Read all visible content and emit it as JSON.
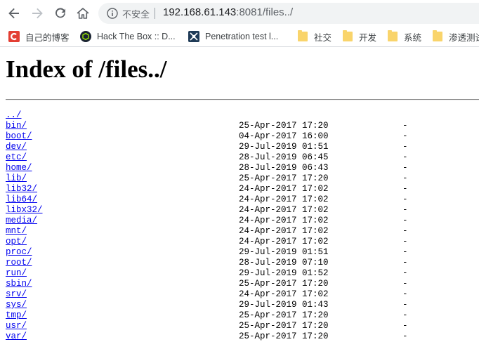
{
  "browser": {
    "security_label": "不安全",
    "url_host": "192.168.61.143",
    "url_rest": ":8081/files../"
  },
  "bookmarks": [
    {
      "label": "自己的博客",
      "icon": "csdn-icon"
    },
    {
      "label": "Hack The Box :: D...",
      "icon": "htb-icon"
    },
    {
      "label": "Penetration test l...",
      "icon": "pentest-icon"
    },
    {
      "label": "社交",
      "icon": "folder-icon"
    },
    {
      "label": "开发",
      "icon": "folder-icon"
    },
    {
      "label": "系统",
      "icon": "folder-icon"
    },
    {
      "label": "渗透测试",
      "icon": "folder-icon"
    }
  ],
  "page": {
    "title": "Index of /files../",
    "parent_link": "../",
    "entries": [
      {
        "name": "bin/",
        "date": "25-Apr-2017 17:20",
        "size": "-"
      },
      {
        "name": "boot/",
        "date": "04-Apr-2017 16:00",
        "size": "-"
      },
      {
        "name": "dev/",
        "date": "29-Jul-2019 01:51",
        "size": "-"
      },
      {
        "name": "etc/",
        "date": "28-Jul-2019 06:45",
        "size": "-"
      },
      {
        "name": "home/",
        "date": "28-Jul-2019 06:43",
        "size": "-"
      },
      {
        "name": "lib/",
        "date": "25-Apr-2017 17:20",
        "size": "-"
      },
      {
        "name": "lib32/",
        "date": "24-Apr-2017 17:02",
        "size": "-"
      },
      {
        "name": "lib64/",
        "date": "24-Apr-2017 17:02",
        "size": "-"
      },
      {
        "name": "libx32/",
        "date": "24-Apr-2017 17:02",
        "size": "-"
      },
      {
        "name": "media/",
        "date": "24-Apr-2017 17:02",
        "size": "-"
      },
      {
        "name": "mnt/",
        "date": "24-Apr-2017 17:02",
        "size": "-"
      },
      {
        "name": "opt/",
        "date": "24-Apr-2017 17:02",
        "size": "-"
      },
      {
        "name": "proc/",
        "date": "29-Jul-2019 01:51",
        "size": "-"
      },
      {
        "name": "root/",
        "date": "28-Jul-2019 07:10",
        "size": "-"
      },
      {
        "name": "run/",
        "date": "29-Jul-2019 01:52",
        "size": "-"
      },
      {
        "name": "sbin/",
        "date": "25-Apr-2017 17:20",
        "size": "-"
      },
      {
        "name": "srv/",
        "date": "24-Apr-2017 17:02",
        "size": "-"
      },
      {
        "name": "sys/",
        "date": "29-Jul-2019 01:43",
        "size": "-"
      },
      {
        "name": "tmp/",
        "date": "25-Apr-2017 17:20",
        "size": "-"
      },
      {
        "name": "usr/",
        "date": "25-Apr-2017 17:20",
        "size": "-"
      },
      {
        "name": "var/",
        "date": "25-Apr-2017 17:20",
        "size": "-"
      }
    ]
  },
  "colors": {
    "link": "#0000ee",
    "csdn_red": "#e33e33",
    "folder": "#f9d46b"
  }
}
